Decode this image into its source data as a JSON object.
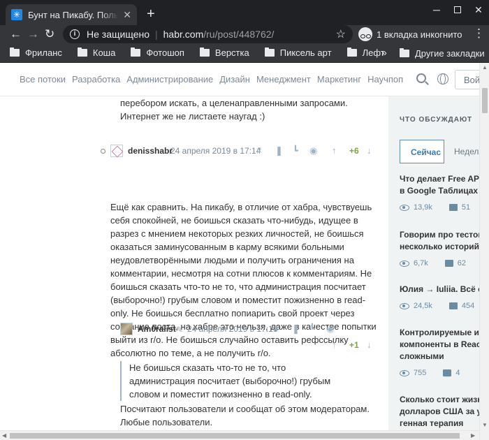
{
  "browser": {
    "tab_title": "Бунт на Пикабу. Пользователи",
    "tab_favicon": "habr-favicon",
    "address": {
      "security_label": "Не защищено",
      "host": "habr.com",
      "path": "/ru/post/448762/"
    },
    "incognito_label": "1 вкладка инкогнито",
    "bookmarks": [
      "Фриланс",
      "Коша",
      "Фотошоп",
      "Верстка",
      "Пиксель арт",
      "Лефт"
    ],
    "bookmarks_more": "»",
    "other_bookmarks": "Другие закладки"
  },
  "site_nav": {
    "links": [
      "Все потоки",
      "Разработка",
      "Администрирование",
      "Дизайн",
      "Менеджмент",
      "Маркетинг",
      "Научпоп"
    ],
    "login_label": "Войти"
  },
  "previous_comment_tail": "перебором искать, а целенаправленными запросами. Интернет же не листаете наугад :)",
  "comments": [
    {
      "user": "denisshabr",
      "date": "24 апреля 2019 в 17:14",
      "score": "+6",
      "text": "Ещё как сравнить. На пикабу, в отличие от хабра, чувствуешь себя спокойней, не боишься сказать что-нибудь, идущее в разрез с мнением некоторых резких личностей, не боишься оказаться заминусованным в карму всякими больными неудовлетворёнными людьми и получить ограничения на комментарии, несмотря на сотни плюсов к комментариям. Не боишься сказать что-то не то, что администрация посчитает (выборочно!) грубым словом и поместит пожизненно в read-only. Не боишься бесплатно попиарить свой проект через создание поста, на хабре это нельзя, даже в качестве попытки выйти из r/o. Не боишься случайно оставить рефссылку абсолютно по теме, а не получить r/o."
    },
    {
      "user": "Am0ralist",
      "date": "24 апреля 2019 в 17:19",
      "score": "+1",
      "quote": "Не боишься сказать что-то не то, что администрация посчитает (выборочно!) грубым словом и поместит пожизненно в read-only.",
      "text": "Посчитают пользователи и сообщат об этом модераторам. Любые пользователи."
    }
  ],
  "sidebar": {
    "title": "ЧТО ОБСУЖДАЮТ",
    "tabs": [
      "Сейчас",
      "Неделя"
    ],
    "items": [
      {
        "title_lines": [
          "Что делает Free API M",
          "в Google Таблицах"
        ],
        "views": "13,9k",
        "comments": "51"
      },
      {
        "title_lines": [
          "Говорим про тестовы",
          "несколько историй и"
        ],
        "views": "6,7k",
        "comments": "62"
      },
      {
        "title_lines": [
          "Юлия → Iuliia. Всё о т"
        ],
        "views": "24,5k",
        "comments": "454"
      },
      {
        "title_lines": [
          "Контролируемые и не",
          "компоненты в React н",
          "сложными"
        ],
        "views": "755",
        "comments": "4"
      },
      {
        "title_lines": [
          "Сколько стоит жизнь",
          "долларов США за уко",
          "генная терапия"
        ]
      }
    ]
  }
}
